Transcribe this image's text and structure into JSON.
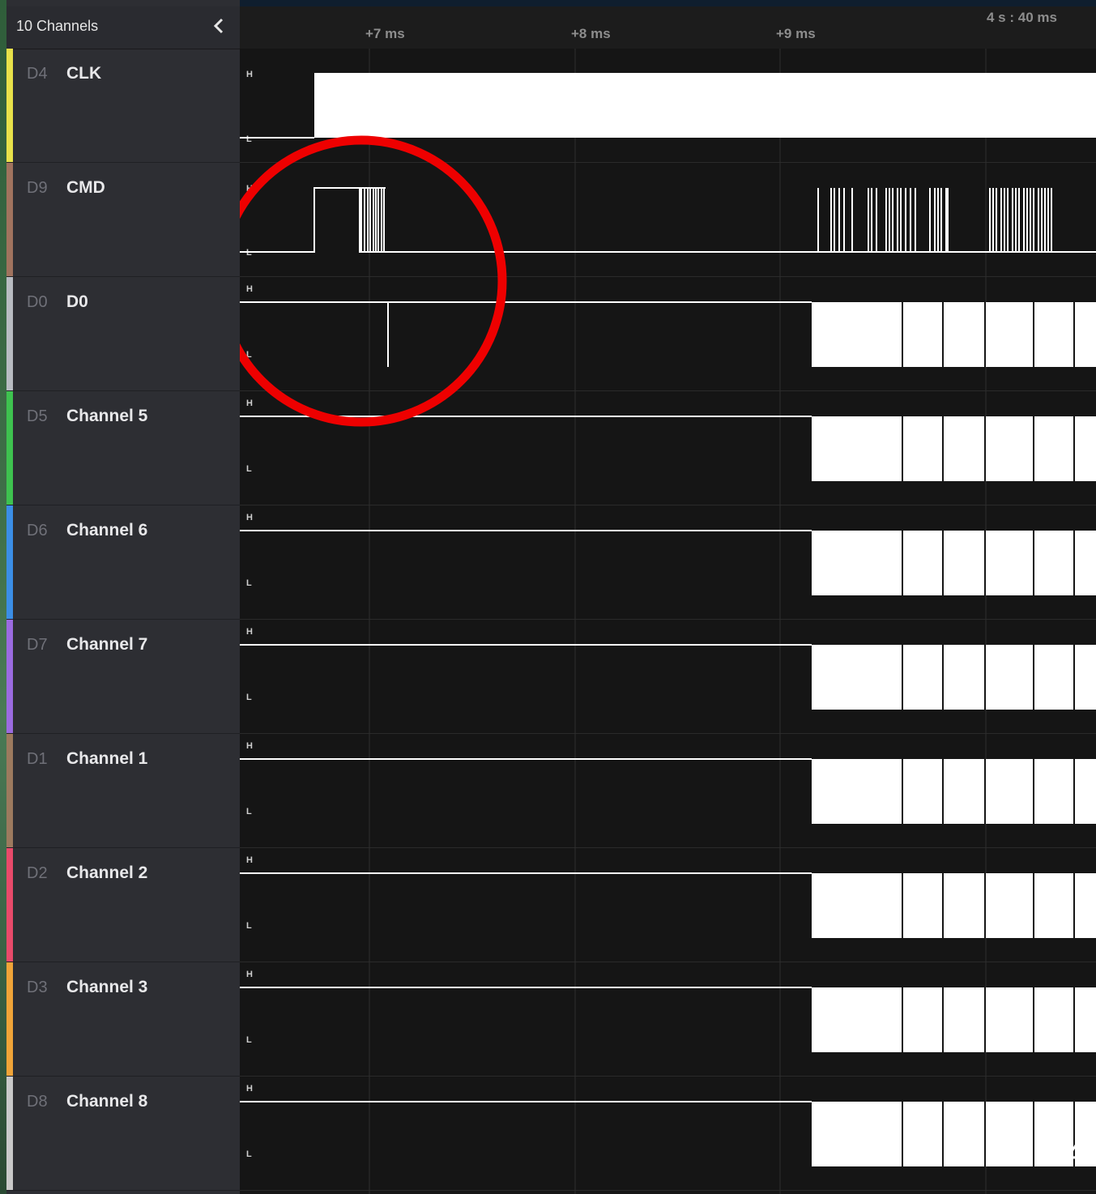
{
  "sidebar": {
    "title": "10 Channels",
    "collapse_icon": "chevron-left-icon",
    "channels": [
      {
        "id": "D4",
        "name": "CLK",
        "color": "#e8e14a"
      },
      {
        "id": "D9",
        "name": "CMD",
        "color": "#a0735e"
      },
      {
        "id": "D0",
        "name": "D0",
        "color": "#b8bcc2"
      },
      {
        "id": "D5",
        "name": "Channel 5",
        "color": "#3ec24f"
      },
      {
        "id": "D6",
        "name": "Channel 6",
        "color": "#3b8ee6"
      },
      {
        "id": "D7",
        "name": "Channel 7",
        "color": "#9b6be0"
      },
      {
        "id": "D1",
        "name": "Channel 1",
        "color": "#9c7a5e"
      },
      {
        "id": "D2",
        "name": "Channel 2",
        "color": "#e84a6a"
      },
      {
        "id": "D3",
        "name": "Channel 3",
        "color": "#f0a438"
      },
      {
        "id": "D8",
        "name": "Channel 8",
        "color": "#c9c9c9"
      }
    ]
  },
  "timeline": {
    "ticks": [
      "+7 ms",
      "+8 ms",
      "+9 ms"
    ],
    "absolute_time": "4 s : 40 ms"
  },
  "levels": {
    "high": "H",
    "low": "L"
  },
  "annotation": {
    "type": "red-circle",
    "color": "#ee0000"
  },
  "page_number": "14"
}
